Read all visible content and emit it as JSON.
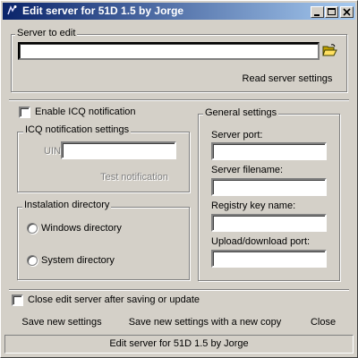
{
  "window": {
    "title": "Edit server for 51D 1.5 by Jorge",
    "controls": [
      "minimize-icon",
      "maximize-icon",
      "close-icon"
    ]
  },
  "server_group": {
    "label": "Server to edit",
    "input_value": "",
    "browse_icon": "folder-open-icon",
    "read_button": "Read server settings"
  },
  "icq": {
    "enable_label": "Enable ICQ notification",
    "enabled": false,
    "group_label": "ICQ notification settings",
    "uin_label": "UIN:",
    "uin_value": "",
    "test_button": "Test notification"
  },
  "install": {
    "group_label": "Instalation directory",
    "options": [
      "Windows directory",
      "System directory"
    ],
    "selected": null
  },
  "general": {
    "group_label": "General settings",
    "fields": [
      {
        "label": "Server port:",
        "value": ""
      },
      {
        "label": "Server filename:",
        "value": ""
      },
      {
        "label": "Registry key name:",
        "value": ""
      },
      {
        "label": "Upload/download port:",
        "value": ""
      }
    ]
  },
  "footer": {
    "close_after_label": "Close edit server after saving or update",
    "close_after_checked": false,
    "save_button": "Save new settings",
    "save_copy_button": "Save new settings with a new copy",
    "close_button": "Close"
  },
  "statusbar": {
    "text": "Edit server for 51D 1.5 by Jorge"
  },
  "colors": {
    "face": "#d4d0c8",
    "title_start": "#0a246a",
    "title_end": "#a6caf0"
  }
}
